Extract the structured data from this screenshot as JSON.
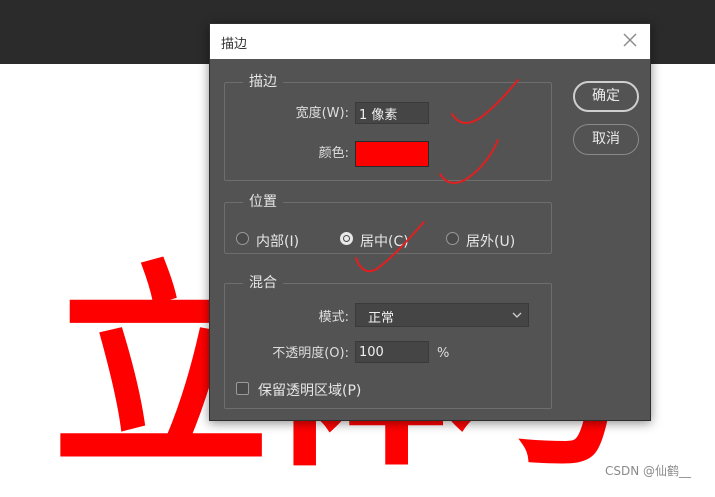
{
  "background": {
    "big_text": "立 体 与",
    "watermark": "CSDN @仙鹤__"
  },
  "dialog": {
    "title": "描边",
    "close_icon": "close-icon",
    "stroke_group": {
      "legend": "描边",
      "width_label": "宽度(W):",
      "width_value": "1 像素",
      "color_label": "颜色:",
      "color_value": "#ff0000"
    },
    "position_group": {
      "legend": "位置",
      "options": [
        {
          "label": "内部(I)",
          "selected": false
        },
        {
          "label": "居中(C)",
          "selected": true
        },
        {
          "label": "居外(U)",
          "selected": false
        }
      ]
    },
    "blend_group": {
      "legend": "混合",
      "mode_label": "模式:",
      "mode_value": "正常",
      "opacity_label": "不透明度(O):",
      "opacity_value": "100",
      "opacity_unit": "%",
      "preserve_label": "保留透明区域(P)",
      "preserve_checked": false
    },
    "ok_label": "确定",
    "cancel_label": "取消"
  },
  "colors": {
    "dialog_bg": "#535353",
    "annotation_red": "#e02020",
    "stroke_color": "#ff0000"
  }
}
